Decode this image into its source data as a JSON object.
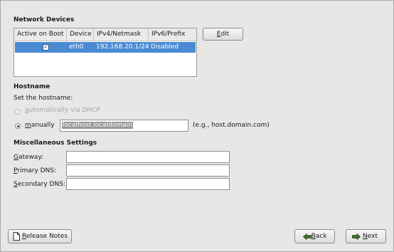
{
  "network_devices": {
    "title": "Network Devices",
    "columns": [
      "Active on Boot",
      "Device",
      "IPv4/Netmask",
      "IPv6/Prefix"
    ],
    "rows": [
      {
        "active_on_boot": "✓",
        "device": "eth0",
        "ipv4": "192.168.20.1/24",
        "ipv6": "Disabled"
      }
    ],
    "edit_button_pre": "",
    "edit_button_mnemonic": "E",
    "edit_button_post": "dit"
  },
  "hostname": {
    "title": "Hostname",
    "set_label": "Set the hostname:",
    "auto_label_mnemonic": "a",
    "auto_label_rest": "utomatically via DHCP",
    "manual_label_mnemonic": "m",
    "manual_label_rest": "anually",
    "manual_value": "localhost.localdomain",
    "example": "(e.g., host.domain.com)"
  },
  "misc": {
    "title": "Miscellaneous Settings",
    "gateway_mnemonic": "G",
    "gateway_rest": "ateway:",
    "primary_dns_mnemonic": "P",
    "primary_dns_rest": "rimary DNS:",
    "secondary_dns_mnemonic": "S",
    "secondary_dns_rest": "econdary DNS:",
    "gateway_value": "",
    "primary_dns_value": "",
    "secondary_dns_value": ""
  },
  "footer": {
    "release_notes_mnemonic": "R",
    "release_notes_rest": "elease Notes",
    "back_mnemonic": "B",
    "back_rest": "ack",
    "next_mnemonic": "N",
    "next_rest": "ext"
  },
  "icons": {
    "release_notes": "document-icon",
    "back": "back-arrow-icon",
    "next": "forward-arrow-icon",
    "checkbox": "checkmark-icon"
  }
}
